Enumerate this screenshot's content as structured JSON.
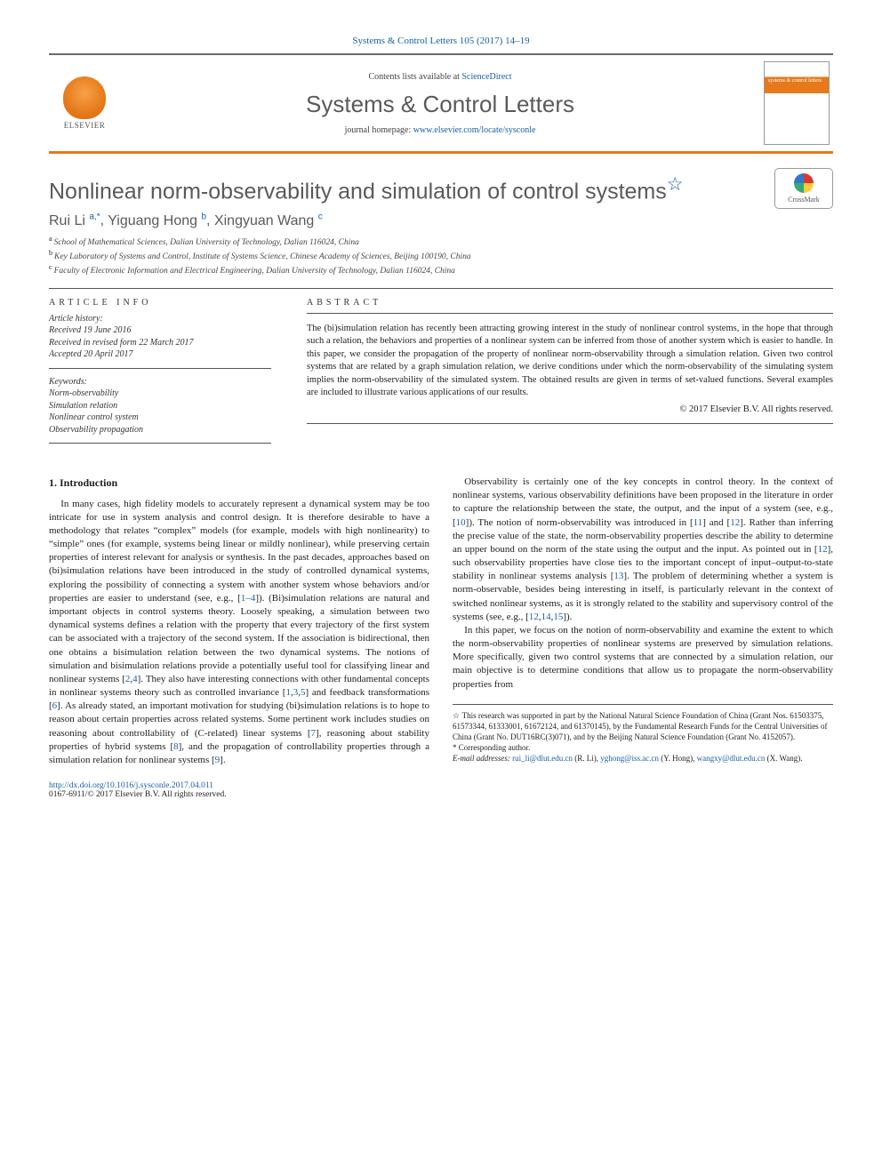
{
  "journal_ref": "Systems & Control Letters 105 (2017) 14–19",
  "header": {
    "contents_pre": "Contents lists available at ",
    "contents_link": "ScienceDirect",
    "journal_title": "Systems & Control Letters",
    "homepage_pre": "journal homepage: ",
    "homepage_link": "www.elsevier.com/locate/sysconle",
    "publisher_name": "ELSEVIER",
    "cover_text": "systems & control letters"
  },
  "title": "Nonlinear norm-observability and simulation of control systems",
  "title_star": "☆",
  "crossmark": "CrossMark",
  "authors_line": {
    "a1": "Rui Li",
    "a1_sup": "a,*",
    "a2": "Yiguang Hong",
    "a2_sup": "b",
    "a3": "Xingyuan Wang",
    "a3_sup": "c"
  },
  "affiliations": {
    "a": "School of Mathematical Sciences, Dalian University of Technology, Dalian 116024, China",
    "b": "Key Laboratory of Systems and Control, Institute of Systems Science, Chinese Academy of Sciences, Beijing 100190, China",
    "c": "Faculty of Electronic Information and Electrical Engineering, Dalian University of Technology, Dalian 116024, China"
  },
  "article_info_label": "ARTICLE INFO",
  "abstract_label": "ABSTRACT",
  "history": {
    "label": "Article history:",
    "received": "Received 19 June 2016",
    "revised": "Received in revised form 22 March 2017",
    "accepted": "Accepted 20 April 2017"
  },
  "keywords": {
    "label": "Keywords:",
    "k1": "Norm-observability",
    "k2": "Simulation relation",
    "k3": "Nonlinear control system",
    "k4": "Observability propagation"
  },
  "abstract": "The (bi)simulation relation has recently been attracting growing interest in the study of nonlinear control systems, in the hope that through such a relation, the behaviors and properties of a nonlinear system can be inferred from those of another system which is easier to handle. In this paper, we consider the propagation of the property of nonlinear norm-observability through a simulation relation. Given two control systems that are related by a graph simulation relation, we derive conditions under which the norm-observability of the simulating system implies the norm-observability of the simulated system. The obtained results are given in terms of set-valued functions. Several examples are included to illustrate various applications of our results.",
  "copyright": "© 2017 Elsevier B.V. All rights reserved.",
  "section1_heading": "1.  Introduction",
  "para1a": "In many cases, high fidelity models to accurately represent a dynamical system may be too intricate for use in system analysis and control design. It is therefore desirable to have a methodology that relates “complex” models (for example, models with high nonlinearity) to “simple” ones (for example, systems being linear or mildly nonlinear), while preserving certain properties of interest relevant for analysis or synthesis. In the past decades, approaches based on (bi)simulation relations have been introduced in the study of controlled dynamical systems, exploring the possibility of connecting a system with another system whose behaviors and/or properties are easier to understand (see, e.g., [",
  "r1_4": "1–4",
  "para1b": "]). (Bi)simulation relations are natural and important objects in control systems theory. Loosely speaking, a simulation between two dynamical systems defines a relation with the property that every trajectory of the first system can be associated with a trajectory of the second system. If the association is bidirectional, then one obtains a bisimulation relation between the two dynamical systems. The notions of simulation and bisimulation relations provide a potentially useful tool for classifying linear and nonlinear systems [",
  "r2": "2",
  "r4": "4",
  "para1c": "]. They also have interesting connections with other fundamental",
  "para2a": "concepts in nonlinear systems theory such as controlled invariance [",
  "r1": "1",
  "r3": "3",
  "r5": "5",
  "para2b": "] and feedback transformations [",
  "r6": "6",
  "para2c": "]. As already stated, an important motivation for studying (bi)simulation relations is to hope to reason about certain properties across related systems. Some pertinent work includes studies on reasoning about controllability of (C-related) linear systems [",
  "r7": "7",
  "para2d": "], reasoning about stability properties of hybrid systems [",
  "r8": "8",
  "para2e": "], and the propagation of controllability properties through a simulation relation for nonlinear systems [",
  "r9": "9",
  "para2f": "].",
  "para3a": "Observability is certainly one of the key concepts in control theory. In the context of nonlinear systems, various observability definitions have been proposed in the literature in order to capture the relationship between the state, the output, and the input of a system (see, e.g., [",
  "r10": "10",
  "para3b": "]). The notion of norm-observability was introduced in [",
  "r11": "11",
  "para3c": "] and [",
  "r12": "12",
  "para3d": "]. Rather than inferring the precise value of the state, the norm-observability properties describe the ability to determine an upper bound on the norm of the state using the output and the input. As pointed out in [",
  "para3e": "], such observability properties have close ties to the important concept of input–output-to-state stability in nonlinear systems analysis [",
  "r13": "13",
  "para3f": "]. The problem of determining whether a system is norm-observable, besides being interesting in itself, is particularly relevant in the context of switched nonlinear systems, as it is strongly related to the stability and supervisory control of the systems (see, e.g., [",
  "r14": "14",
  "r15": "15",
  "para3g": "]).",
  "para4": "In this paper, we focus on the notion of norm-observability and examine the extent to which the norm-observability properties of nonlinear systems are preserved by simulation relations. More specifically, given two control systems that are connected by a simulation relation, our main objective is to determine conditions that allow us to propagate the norm-observability properties from",
  "funding_note": "This research was supported in part by the National Natural Science Foundation of China (Grant Nos. 61503375, 61573344, 61333001, 61672124, and 61370145), by the Fundamental Research Funds for the Central Universities of China (Grant No. DUT16RC(3)071), and by the Beijing Natural Science Foundation (Grant No. 4152057).",
  "corr_label": "Corresponding author.",
  "email_label": "E-mail addresses:",
  "emails": {
    "e1": "rui_li@dlut.edu.cn",
    "e1n": " (R. Li), ",
    "e2": "yghong@iss.ac.cn",
    "e2n": " (Y. Hong), ",
    "e3": "wangxy@dlut.edu.cn",
    "e3n": " (X. Wang)."
  },
  "doi": "http://dx.doi.org/10.1016/j.sysconle.2017.04.011",
  "issn_line": "0167-6911/© 2017 Elsevier B.V. All rights reserved."
}
